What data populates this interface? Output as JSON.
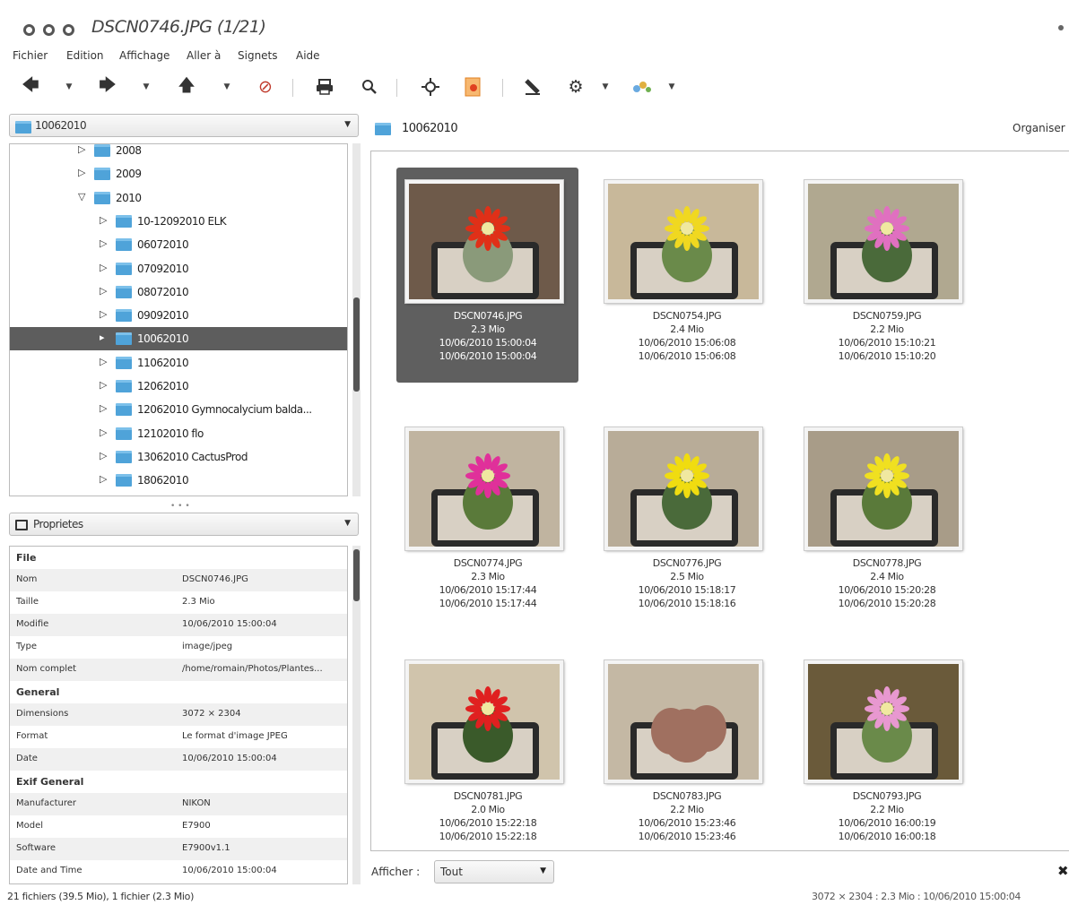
{
  "window": {
    "title": "DSCN0746.JPG (1/21)"
  },
  "menu": [
    "Fichier",
    "Edition",
    "Affichage",
    "Aller à",
    "Signets",
    "Aide"
  ],
  "toolbar": {
    "icons": [
      "back-arrow-icon",
      "back-dropdown-icon",
      "forward-arrow-icon",
      "forward-dropdown-icon",
      "up-arrow-icon",
      "up-dropdown-icon",
      "stop-icon",
      "print-icon",
      "search-icon",
      "fullscreen-icon",
      "slideshow-icon",
      "edit-icon",
      "settings-icon",
      "settings-dropdown-icon",
      "plugins-icon",
      "plugins-dropdown-icon"
    ]
  },
  "folder_combo": {
    "value": "10062010"
  },
  "tree": {
    "items": [
      {
        "label": "2008",
        "expander": "▷",
        "level": 1
      },
      {
        "label": "2009",
        "expander": "▷",
        "level": 1
      },
      {
        "label": "2010",
        "expander": "▽",
        "level": 1
      },
      {
        "label": "10-12092010 ELK",
        "expander": "▷",
        "level": 2
      },
      {
        "label": "06072010",
        "expander": "▷",
        "level": 2
      },
      {
        "label": "07092010",
        "expander": "▷",
        "level": 2
      },
      {
        "label": "08072010",
        "expander": "▷",
        "level": 2
      },
      {
        "label": "09092010",
        "expander": "▷",
        "level": 2
      },
      {
        "label": "10062010",
        "expander": "▸",
        "level": 2,
        "selected": true
      },
      {
        "label": "11062010",
        "expander": "▷",
        "level": 2
      },
      {
        "label": "12062010",
        "expander": "▷",
        "level": 2
      },
      {
        "label": "12062010 Gymnocalycium balda...",
        "expander": "▷",
        "level": 2
      },
      {
        "label": "12102010 flo",
        "expander": "▷",
        "level": 2
      },
      {
        "label": "13062010 CactusProd",
        "expander": "▷",
        "level": 2
      },
      {
        "label": "18062010",
        "expander": "▷",
        "level": 2
      }
    ]
  },
  "properties_combo": {
    "value": "Proprietes"
  },
  "properties": [
    {
      "key": "File",
      "value": "",
      "header": true
    },
    {
      "key": "Nom",
      "value": "DSCN0746.JPG"
    },
    {
      "key": "Taille",
      "value": "2.3 Mio"
    },
    {
      "key": "Modifie",
      "value": "10/06/2010 15:00:04"
    },
    {
      "key": "Type",
      "value": "image/jpeg"
    },
    {
      "key": "Nom complet",
      "value": "/home/romain/Photos/Plantes..."
    },
    {
      "key": "General",
      "value": "",
      "header": true
    },
    {
      "key": "Dimensions",
      "value": "3072 × 2304"
    },
    {
      "key": "Format",
      "value": "Le format d'image JPEG"
    },
    {
      "key": "Date",
      "value": "10/06/2010 15:00:04"
    },
    {
      "key": "Exif General",
      "value": "",
      "header": true
    },
    {
      "key": "Manufacturer",
      "value": "NIKON"
    },
    {
      "key": "Model",
      "value": "E7900"
    },
    {
      "key": "Software",
      "value": "E7900v1.1"
    },
    {
      "key": "Date and Time",
      "value": "10/06/2010 15:00:04"
    }
  ],
  "main": {
    "folder_title": "10062010",
    "organize_label": "Organiser"
  },
  "thumbnails": [
    {
      "name": "DSCN0746.JPG",
      "size": "2.3 Mio",
      "date1": "10/06/2010 15:00:04",
      "date2": "10/06/2010 15:00:04",
      "selected": true,
      "bg": "#6e5a4a",
      "plant": "#8a9a7a",
      "flower": "#e03018",
      "flowerType": "red"
    },
    {
      "name": "DSCN0754.JPG",
      "size": "2.4 Mio",
      "date1": "10/06/2010 15:06:08",
      "date2": "10/06/2010 15:06:08",
      "bg": "#c8b89a",
      "plant": "#6a8a4a",
      "flower": "#f0d820",
      "flowerType": "yellow"
    },
    {
      "name": "DSCN0759.JPG",
      "size": "2.2 Mio",
      "date1": "10/06/2010 15:10:21",
      "date2": "10/06/2010 15:10:20",
      "bg": "#b0a890",
      "plant": "#4a6a3a",
      "flower": "#e070c0",
      "flowerType": "pink"
    },
    {
      "name": "DSCN0774.JPG",
      "size": "2.3 Mio",
      "date1": "10/06/2010 15:17:44",
      "date2": "10/06/2010 15:17:44",
      "bg": "#c0b4a0",
      "plant": "#5a7a3a",
      "flower": "#e0309a",
      "flowerType": "pink"
    },
    {
      "name": "DSCN0776.JPG",
      "size": "2.5 Mio",
      "date1": "10/06/2010 15:18:17",
      "date2": "10/06/2010 15:18:16",
      "bg": "#b8ac98",
      "plant": "#4a6a3a",
      "flower": "#f0dc10",
      "flowerType": "yellow"
    },
    {
      "name": "DSCN0778.JPG",
      "size": "2.4 Mio",
      "date1": "10/06/2010 15:20:28",
      "date2": "10/06/2010 15:20:28",
      "bg": "#a89c88",
      "plant": "#5a7a3a",
      "flower": "#f0e020",
      "flowerType": "yellow"
    },
    {
      "name": "DSCN0781.JPG",
      "size": "2.0 Mio",
      "date1": "10/06/2010 15:22:18",
      "date2": "10/06/2010 15:22:18",
      "bg": "#d0c4ac",
      "plant": "#3a5a2a",
      "flower": "#e02020",
      "flowerType": "red"
    },
    {
      "name": "DSCN0783.JPG",
      "size": "2.2 Mio",
      "date1": "10/06/2010 15:23:46",
      "date2": "10/06/2010 15:23:46",
      "bg": "#c4b8a4",
      "plant": "#a07060",
      "flower": "#a07060",
      "flowerType": "stone"
    },
    {
      "name": "DSCN0793.JPG",
      "size": "2.2 Mio",
      "date1": "10/06/2010 16:00:19",
      "date2": "10/06/2010 16:00:18",
      "bg": "#6a5a3a",
      "plant": "#6a8a4a",
      "flower": "#e898d0",
      "flowerType": "pink"
    }
  ],
  "filter": {
    "label": "Afficher :",
    "value": "Tout"
  },
  "status": {
    "left": "21 fichiers (39.5 Mio), 1 fichier (2.3 Mio)",
    "right": "3072 × 2304 : 2.3 Mio : 10/06/2010 15:00:04"
  }
}
